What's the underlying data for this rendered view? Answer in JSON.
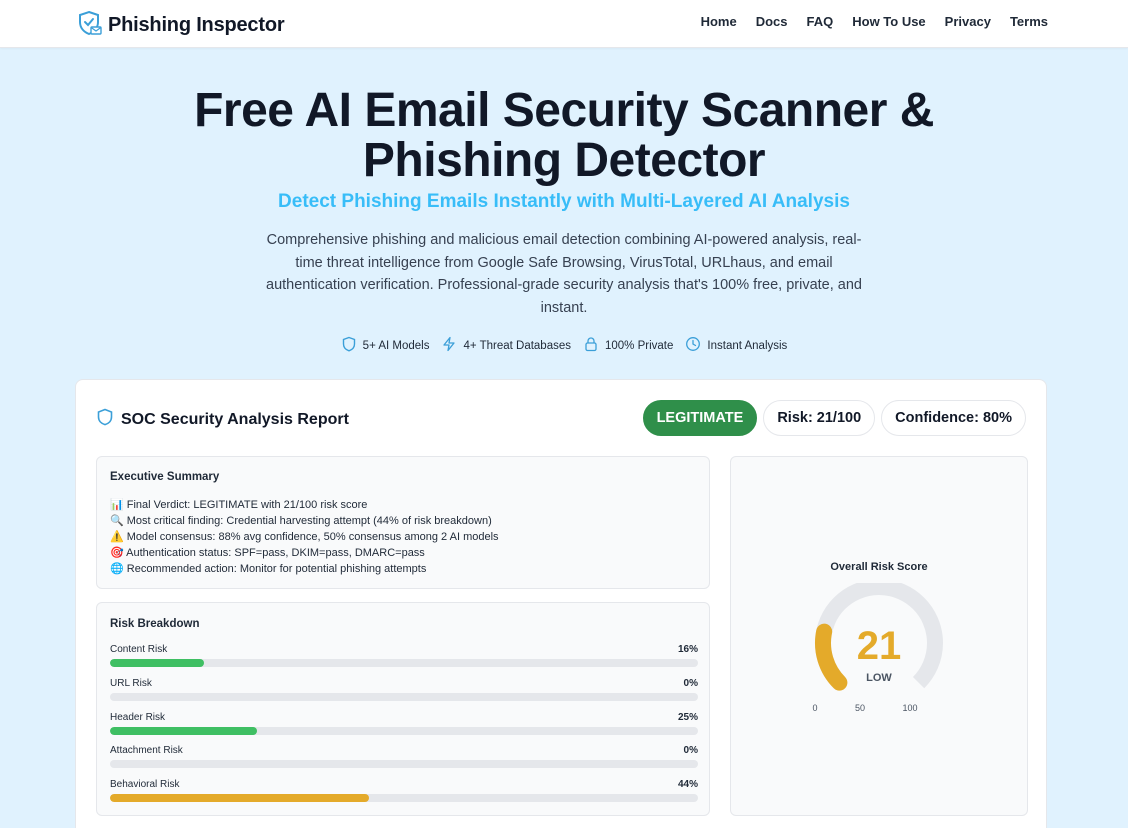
{
  "header": {
    "brand": "Phishing Inspector",
    "nav": [
      "Home",
      "Docs",
      "FAQ",
      "How To Use",
      "Privacy",
      "Terms"
    ]
  },
  "hero": {
    "title_line1": "Free AI Email Security Scanner &",
    "title_line2": "Phishing Detector",
    "subtitle": "Detect Phishing Emails Instantly with Multi-Layered AI Analysis",
    "description": "Comprehensive phishing and malicious email detection combining AI-powered analysis, real-time threat intelligence from Google Safe Browsing, VirusTotal, URLhaus, and email authentication verification. Professional-grade security analysis that's 100% free, private, and instant.",
    "features": [
      {
        "icon": "shield-icon",
        "label": "5+ AI Models"
      },
      {
        "icon": "lightning-icon",
        "label": "4+ Threat Databases"
      },
      {
        "icon": "lock-icon",
        "label": "100% Private"
      },
      {
        "icon": "clock-icon",
        "label": "Instant Analysis"
      }
    ]
  },
  "report": {
    "title": "SOC Security Analysis Report",
    "verdict": "LEGITIMATE",
    "risk": "Risk: 21/100",
    "confidence": "Confidence: 80%",
    "executive_summary": {
      "title": "Executive Summary",
      "lines": [
        "📊 Final Verdict: LEGITIMATE with 21/100 risk score",
        "🔍 Most critical finding: Credential harvesting attempt (44% of risk breakdown)",
        "⚠️ Model consensus: 88% avg confidence, 50% consensus among 2 AI models",
        "🎯 Authentication status: SPF=pass, DKIM=pass, DMARC=pass",
        "🌐 Recommended action: Monitor for potential phishing attempts"
      ]
    },
    "risk_breakdown": {
      "title": "Risk Breakdown",
      "rows": [
        {
          "label": "Content Risk",
          "value": "16%",
          "pct": 16,
          "color": "#3fbf63"
        },
        {
          "label": "URL Risk",
          "value": "0%",
          "pct": 0,
          "color": "#3fbf63"
        },
        {
          "label": "Header Risk",
          "value": "25%",
          "pct": 25,
          "color": "#3fbf63"
        },
        {
          "label": "Attachment Risk",
          "value": "0%",
          "pct": 0,
          "color": "#3fbf63"
        },
        {
          "label": "Behavioral Risk",
          "value": "44%",
          "pct": 44,
          "color": "#e4aa2a"
        }
      ]
    },
    "gauge": {
      "title": "Overall Risk Score",
      "score": "21",
      "score_value": 21,
      "level": "LOW",
      "ticks": [
        "0",
        "50",
        "100"
      ],
      "color": "#e4aa2a",
      "track_color": "#e5e7eb"
    }
  },
  "colors": {
    "accent": "#38bdf8",
    "legit": "#2f8f4a",
    "hero_bg": "#e0f2fe"
  }
}
